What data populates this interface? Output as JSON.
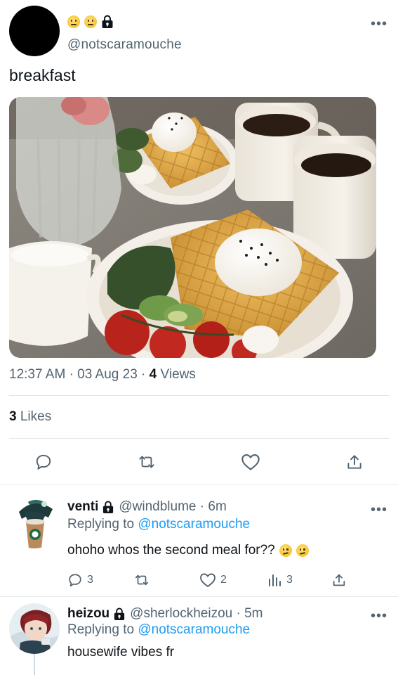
{
  "tweet": {
    "handle": "@notscaramouche",
    "text": "breakfast",
    "time": "12:37 AM",
    "date": "03 Aug 23",
    "views_count": "4",
    "views_label": "Views",
    "likes_count": "3",
    "likes_label": "Likes",
    "more_label": "•••"
  },
  "replies": [
    {
      "name": "venti",
      "handle": "@windblume",
      "time": "6m",
      "replying_prefix": "Replying to",
      "replying_to": "@notscaramouche",
      "text": "ohoho whos the second meal for??",
      "reply_count": "3",
      "like_count": "2",
      "view_count": "3",
      "more_label": "•••"
    },
    {
      "name": "heizou",
      "handle": "@sherlockheizou",
      "time": "5m",
      "replying_prefix": "Replying to",
      "replying_to": "@notscaramouche",
      "text": "housewife vibes fr",
      "more_label": "•••"
    }
  ],
  "colors": {
    "accent": "#1d9bf0",
    "muted": "#536471",
    "text": "#0f1419"
  }
}
